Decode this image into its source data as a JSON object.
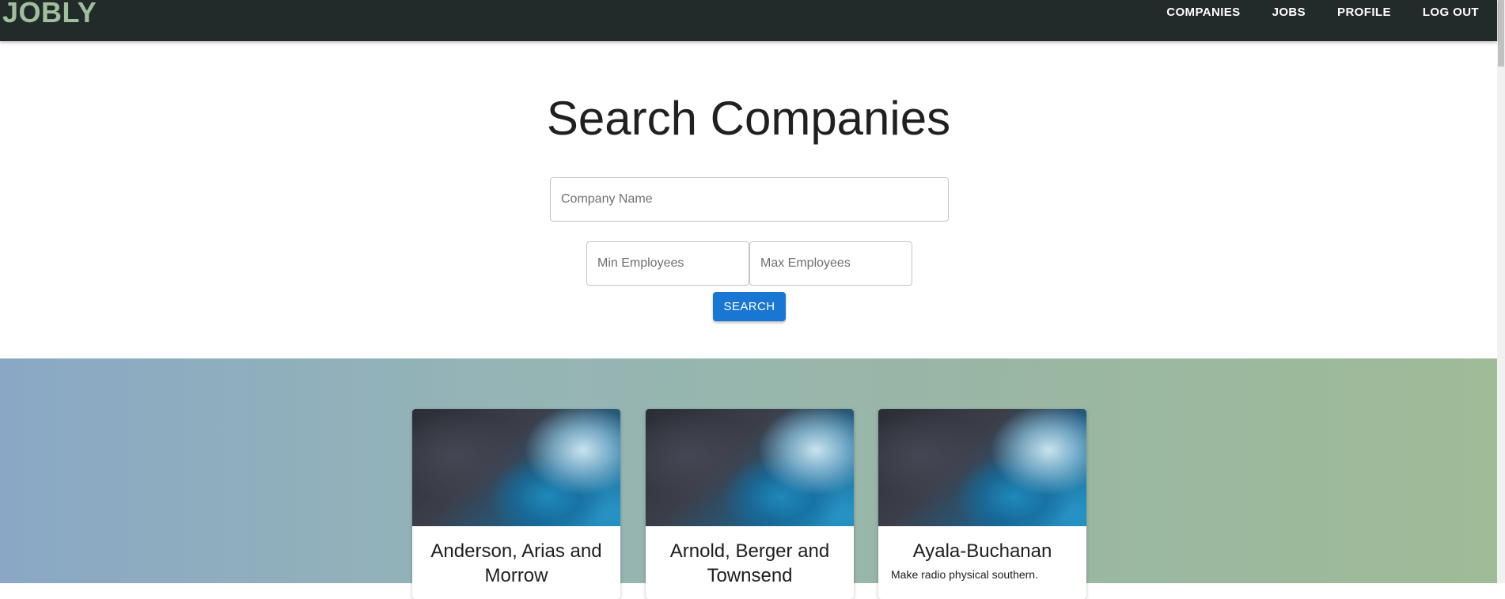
{
  "navbar": {
    "brand": "JOBLY",
    "links": [
      "COMPANIES",
      "JOBS",
      "PROFILE",
      "LOG OUT"
    ]
  },
  "search": {
    "title": "Search Companies",
    "company_placeholder": "Company Name",
    "min_placeholder": "Min Employees",
    "max_placeholder": "Max Employees",
    "button_label": "SEARCH"
  },
  "companies": [
    {
      "name": "Anderson, Arias and Morrow",
      "description": ""
    },
    {
      "name": "Arnold, Berger and Townsend",
      "description": ""
    },
    {
      "name": "Ayala-Buchanan",
      "description": "Make radio physical southern."
    }
  ],
  "colors": {
    "navbar_bg": "#222b2a",
    "brand": "#9fbf9d",
    "primary_button": "#1976d2"
  }
}
